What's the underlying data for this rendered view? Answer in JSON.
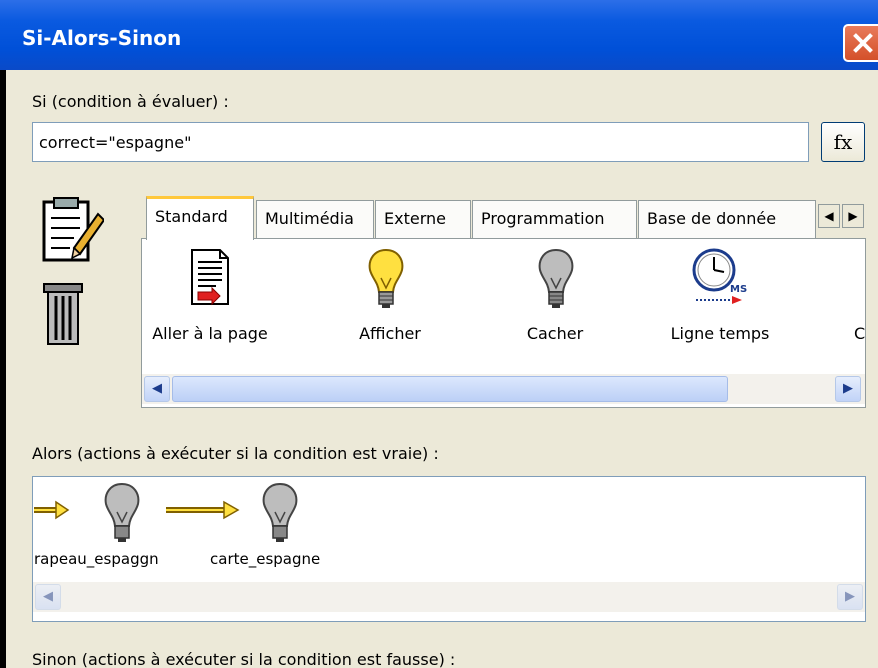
{
  "window": {
    "title": "Si-Alors-Sinon",
    "close_icon": "close-icon"
  },
  "condition": {
    "label": "Si (condition à évaluer) :",
    "value": "correct=\"espagne\"",
    "fx_label": "fx"
  },
  "left_icons": [
    "clipboard-icon",
    "trash-icon"
  ],
  "tabs": [
    {
      "label": "Standard",
      "selected": true
    },
    {
      "label": "Multimédia",
      "selected": false
    },
    {
      "label": "Externe",
      "selected": false
    },
    {
      "label": "Programmation",
      "selected": false
    },
    {
      "label": "Base de donnée",
      "selected": false
    }
  ],
  "palette": [
    {
      "label": "Aller à la page",
      "icon": "goto-page-icon"
    },
    {
      "label": "Afficher",
      "icon": "bulb-on-icon"
    },
    {
      "label": "Cacher",
      "icon": "bulb-off-icon"
    },
    {
      "label": "Ligne temps",
      "icon": "timeline-clock-icon"
    },
    {
      "label": "C",
      "icon": ""
    }
  ],
  "then_section": {
    "label": "Alors (actions à exécuter si la condition est vraie) :",
    "items": [
      {
        "label": "rapeau_espaggn",
        "icon": "bulb-off-icon"
      },
      {
        "label": "carte_espagne",
        "icon": "bulb-off-icon"
      }
    ]
  },
  "else_section": {
    "label": "Sinon (actions à exécuter si la condition est fausse) :"
  },
  "colors": {
    "titlebar": "#0a5ae0",
    "dialog": "#ece9d8",
    "tab_highlight": "#ffc83c",
    "close": "#d4502a"
  }
}
